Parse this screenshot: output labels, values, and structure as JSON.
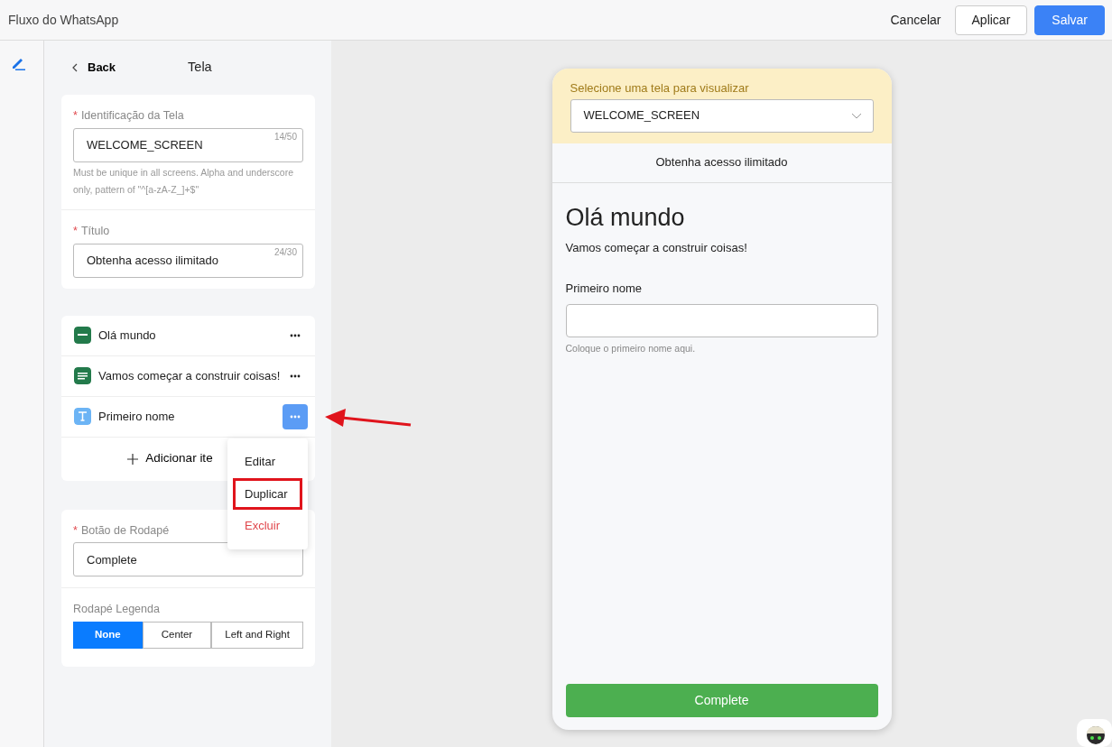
{
  "app_title": "Fluxo do WhatsApp",
  "header_buttons": [
    {
      "label": "Cancelar",
      "kind": "link"
    },
    {
      "label": "Aplicar",
      "kind": "outline"
    },
    {
      "label": "Salvar",
      "kind": "primary"
    }
  ],
  "panel": {
    "back": "Back",
    "title": "Tela",
    "fields": [
      {
        "label": "Identificação da Tela",
        "required_mark": "*",
        "value": "WELCOME_SCREEN",
        "counter": "14/50",
        "help": "Must be unique in all screens. Alpha and underscore only, pattern of \"^[a-zA-Z_]+$\""
      },
      {
        "label": "Título",
        "required_mark": "*",
        "value": "Obtenha acesso ilimitado",
        "counter": "24/30"
      }
    ],
    "items": [
      {
        "label": "Olá mundo",
        "kind": "heading",
        "active": false
      },
      {
        "label": "Vamos começar a construir coisas!",
        "kind": "body",
        "active": false
      },
      {
        "label": "Primeiro nome",
        "kind": "input",
        "active": true
      }
    ],
    "add_item": "Adicionar ite",
    "footer_field": {
      "label": "Botão de Rodapé",
      "required_mark": "*",
      "value": "Complete"
    },
    "caption": {
      "label": "Rodapé Legenda",
      "options": [
        {
          "label": "None",
          "selected": true
        },
        {
          "label": "Center",
          "selected": false
        },
        {
          "label": "Left and Right",
          "selected": false
        }
      ]
    }
  },
  "menu": [
    {
      "label": "Editar",
      "kind": "normal",
      "highlighted": false
    },
    {
      "label": "Duplicar",
      "kind": "normal",
      "highlighted": true
    },
    {
      "label": "Excluir",
      "kind": "danger",
      "highlighted": false
    }
  ],
  "preview": {
    "select_label": "Selecione uma tela para visualizar",
    "select_value": "WELCOME_SCREEN",
    "screen_title": "Obtenha acesso ilimitado",
    "heading": "Olá mundo",
    "body": "Vamos começar a construir coisas!",
    "input_label": "Primeiro nome",
    "input_help": "Coloque o primeiro nome aqui.",
    "button": "Complete"
  }
}
